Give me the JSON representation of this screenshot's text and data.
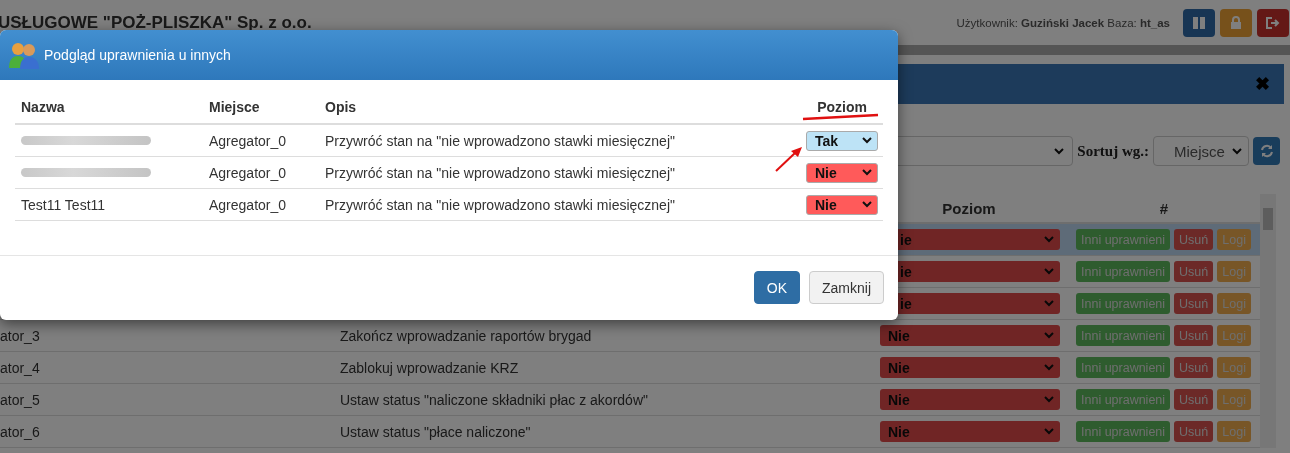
{
  "header": {
    "company_title": "USŁUGOWE \"POŻ-PLISZKA\" Sp. z o.o.",
    "user_info": "Użytkownik: **Guziński Jacek** Baza: **ht_as**",
    "buttons": [
      {
        "kind": "columns"
      },
      {
        "kind": "lock"
      },
      {
        "kind": "logout"
      }
    ]
  },
  "panel": {
    "close": "✖",
    "sort_label": "Sortuj wg.:",
    "sort_value": "Miejsce",
    "table": {
      "columns": [
        "Poziom",
        "#"
      ],
      "rows": [
        {
          "kind": "covered",
          "selected": true,
          "poziom": "ie",
          "actions": [
            {
              "label": "Inni uprawnieni",
              "kind": "success"
            },
            {
              "label": "Usuń",
              "kind": "danger"
            },
            {
              "label": "Logi",
              "kind": "warning"
            }
          ]
        },
        {
          "kind": "covered",
          "selected": false,
          "poziom": "ie",
          "actions": [
            {
              "label": "Inni uprawnieni",
              "kind": "success"
            },
            {
              "label": "Usuń",
              "kind": "danger"
            },
            {
              "label": "Logi",
              "kind": "warning"
            }
          ]
        },
        {
          "kind": "covered",
          "selected": false,
          "poziom": "ie",
          "actions": [
            {
              "label": "Inni uprawnieni",
              "kind": "success"
            },
            {
              "label": "Usuń",
              "kind": "danger"
            },
            {
              "label": "Logi",
              "kind": "warning"
            }
          ]
        },
        {
          "kind": "full",
          "selected": false,
          "miejsce": "ator_3",
          "opis": "Zakończ wprowadzanie raportów brygad",
          "poziom": "Nie",
          "actions": [
            {
              "label": "Inni uprawnieni",
              "kind": "success"
            },
            {
              "label": "Usuń",
              "kind": "danger"
            },
            {
              "label": "Logi",
              "kind": "warning"
            }
          ]
        },
        {
          "kind": "full",
          "selected": false,
          "miejsce": "ator_4",
          "opis": "Zablokuj wprowadzanie KRZ",
          "poziom": "Nie",
          "actions": [
            {
              "label": "Inni uprawnieni",
              "kind": "success"
            },
            {
              "label": "Usuń",
              "kind": "danger"
            },
            {
              "label": "Logi",
              "kind": "warning"
            }
          ]
        },
        {
          "kind": "full",
          "selected": false,
          "miejsce": "ator_5",
          "opis": "Ustaw status \"naliczone składniki płac z akordów\"",
          "poziom": "Nie",
          "actions": [
            {
              "label": "Inni uprawnieni",
              "kind": "success"
            },
            {
              "label": "Usuń",
              "kind": "danger"
            },
            {
              "label": "Logi",
              "kind": "warning"
            }
          ]
        },
        {
          "kind": "full",
          "selected": false,
          "miejsce": "ator_6",
          "opis": "Ustaw status \"płace naliczone\"",
          "poziom": "Nie",
          "actions": [
            {
              "label": "Inni uprawnieni",
              "kind": "success"
            },
            {
              "label": "Usuń",
              "kind": "danger"
            },
            {
              "label": "Logi",
              "kind": "warning"
            }
          ]
        }
      ]
    }
  },
  "dialog": {
    "title": "Podgląd uprawnienia u innych",
    "columns": [
      "Nazwa",
      "Miejsce",
      "Opis",
      "Poziom"
    ],
    "rows": [
      {
        "kind": "redacted",
        "miejsce": "Agregator_0",
        "opis": "Przywróć stan na \"nie wprowadzono stawki miesięcznej\"",
        "poziom": "Tak",
        "color": "#bde3f6"
      },
      {
        "kind": "redacted",
        "miejsce": "Agregator_0",
        "opis": "Przywróć stan na \"nie wprowadzono stawki miesięcznej\"",
        "poziom": "Nie",
        "color": "#ff5a5a"
      },
      {
        "kind": "text",
        "nazwa": "Test11 Test11",
        "miejsce": "Agregator_0",
        "opis": "Przywróć stan na \"nie wprowadzono stawki miesięcznej\"",
        "poziom": "Nie",
        "color": "#ff5a5a"
      }
    ],
    "buttons": [
      {
        "label": "OK",
        "kind": "primary"
      },
      {
        "label": "Zamknij",
        "kind": "default"
      }
    ]
  }
}
